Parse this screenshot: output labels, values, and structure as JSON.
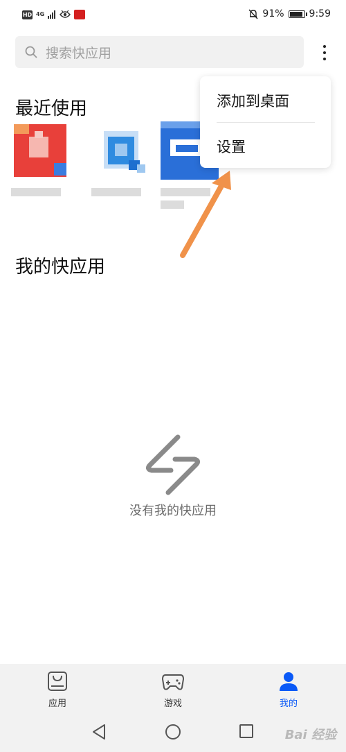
{
  "status_bar": {
    "hd": "HD",
    "network": "4G",
    "battery_percent": "91%",
    "battery_level": 0.91,
    "time": "9:59"
  },
  "search": {
    "placeholder": "搜索快应用"
  },
  "menu": {
    "items": [
      {
        "label": "添加到桌面"
      },
      {
        "label": "设置"
      }
    ]
  },
  "recent": {
    "title": "最近使用",
    "apps": [
      {
        "icon": "red-app-icon",
        "color": "#e8403a"
      },
      {
        "icon": "blue-search-app-icon",
        "color": "#2f8be0"
      },
      {
        "icon": "blue-app-icon",
        "color": "#2a6fd8"
      }
    ]
  },
  "mine": {
    "title": "我的快应用",
    "empty_text": "没有我的快应用"
  },
  "tabs": [
    {
      "label": "应用",
      "icon": "app-store-icon",
      "active": false
    },
    {
      "label": "游戏",
      "icon": "gamepad-icon",
      "active": false
    },
    {
      "label": "我的",
      "icon": "person-icon",
      "active": true
    }
  ],
  "nav": {
    "watermark": "Bai 经验"
  },
  "colors": {
    "accent": "#0a59f7",
    "arrow": "#f0924a",
    "search_bg": "#f1f1f1"
  }
}
